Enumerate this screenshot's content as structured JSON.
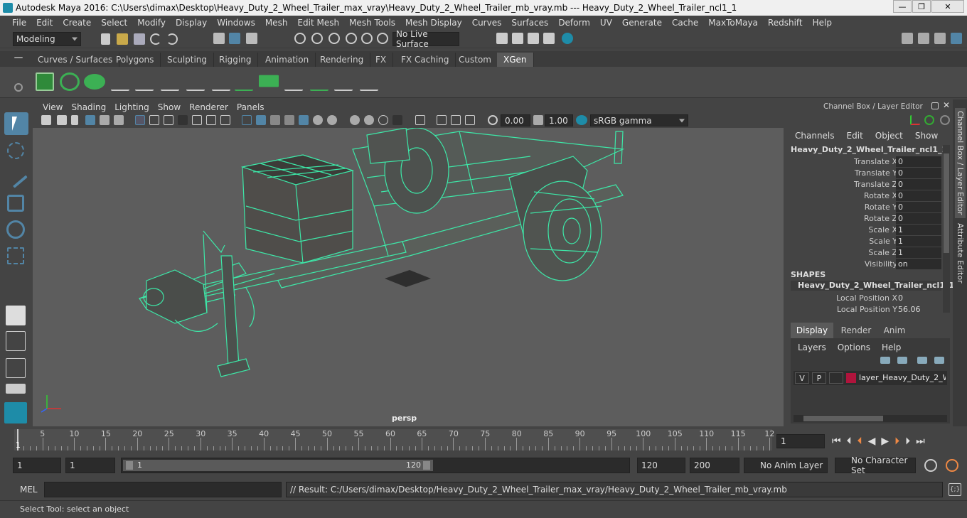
{
  "window": {
    "title": "Autodesk Maya 2016: C:\\Users\\dimax\\Desktop\\Heavy_Duty_2_Wheel_Trailer_max_vray\\Heavy_Duty_2_Wheel_Trailer_mb_vray.mb   ---   Heavy_Duty_2_Wheel_Trailer_ncl1_1",
    "minimize": "—",
    "maximize": "❐",
    "close": "✕"
  },
  "menubar": [
    "File",
    "Edit",
    "Create",
    "Select",
    "Modify",
    "Display",
    "Windows",
    "Mesh",
    "Edit Mesh",
    "Mesh Tools",
    "Mesh Display",
    "Curves",
    "Surfaces",
    "Deform",
    "UV",
    "Generate",
    "Cache",
    "MaxToMaya",
    "Redshift",
    "Help"
  ],
  "statusline": {
    "mode": "Modeling",
    "live_surface": "No Live Surface"
  },
  "shelf_tabs": [
    "Curves / Surfaces",
    "Polygons",
    "Sculpting",
    "Rigging",
    "Animation",
    "Rendering",
    "FX",
    "FX Caching",
    "Custom",
    "XGen"
  ],
  "active_shelf": "XGen",
  "viewport": {
    "menu": [
      "View",
      "Shading",
      "Lighting",
      "Show",
      "Renderer",
      "Panels"
    ],
    "exposure": "0.00",
    "gamma": "1.00",
    "color_space": "sRGB gamma",
    "camera_label": "persp"
  },
  "channel_box": {
    "header": "Channel Box / Layer Editor",
    "menu": [
      "Channels",
      "Edit",
      "Object",
      "Show"
    ],
    "object_name": "Heavy_Duty_2_Wheel_Trailer_ncl1_1",
    "attributes": [
      {
        "label": "Translate X",
        "value": "0"
      },
      {
        "label": "Translate Y",
        "value": "0"
      },
      {
        "label": "Translate Z",
        "value": "0"
      },
      {
        "label": "Rotate X",
        "value": "0"
      },
      {
        "label": "Rotate Y",
        "value": "0"
      },
      {
        "label": "Rotate Z",
        "value": "0"
      },
      {
        "label": "Scale X",
        "value": "1"
      },
      {
        "label": "Scale Y",
        "value": "1"
      },
      {
        "label": "Scale Z",
        "value": "1"
      },
      {
        "label": "Visibility",
        "value": "on"
      }
    ],
    "shapes_header": "SHAPES",
    "shape_name": "Heavy_Duty_2_Wheel_Trailer_ncl1_1...",
    "shape_attributes": [
      {
        "label": "Local Position X",
        "value": "0"
      },
      {
        "label": "Local Position Y",
        "value": "56.06"
      }
    ]
  },
  "layer_editor": {
    "tabs": [
      "Display",
      "Render",
      "Anim"
    ],
    "active_tab": "Display",
    "menu": [
      "Layers",
      "Options",
      "Help"
    ],
    "layer": {
      "v": "V",
      "p": "P",
      "name": "layer_Heavy_Duty_2_Wheel_Trailer",
      "color": "#b0143c"
    }
  },
  "side_tabs": [
    "Channel Box / Layer Editor",
    "Attribute Editor"
  ],
  "timeline": {
    "ticks": [
      "5",
      "10",
      "15",
      "20",
      "25",
      "30",
      "35",
      "40",
      "45",
      "50",
      "55",
      "60",
      "65",
      "70",
      "75",
      "80",
      "85",
      "90",
      "95",
      "100",
      "105",
      "110",
      "115",
      "12"
    ],
    "start_label": "1",
    "current_frame": "1"
  },
  "range": {
    "start": "1",
    "playback_start": "1",
    "slider_start": "1",
    "slider_end": "120",
    "playback_end": "120",
    "end": "200",
    "anim_layer": "No Anim Layer",
    "character_set": "No Character Set"
  },
  "command": {
    "lang": "MEL",
    "result": "// Result: C:/Users/dimax/Desktop/Heavy_Duty_2_Wheel_Trailer_max_vray/Heavy_Duty_2_Wheel_Trailer_mb_vray.mb"
  },
  "help_line": "Select Tool: select an object",
  "colors": {
    "wire": "#3de8a8",
    "accent": "#5285a6"
  }
}
